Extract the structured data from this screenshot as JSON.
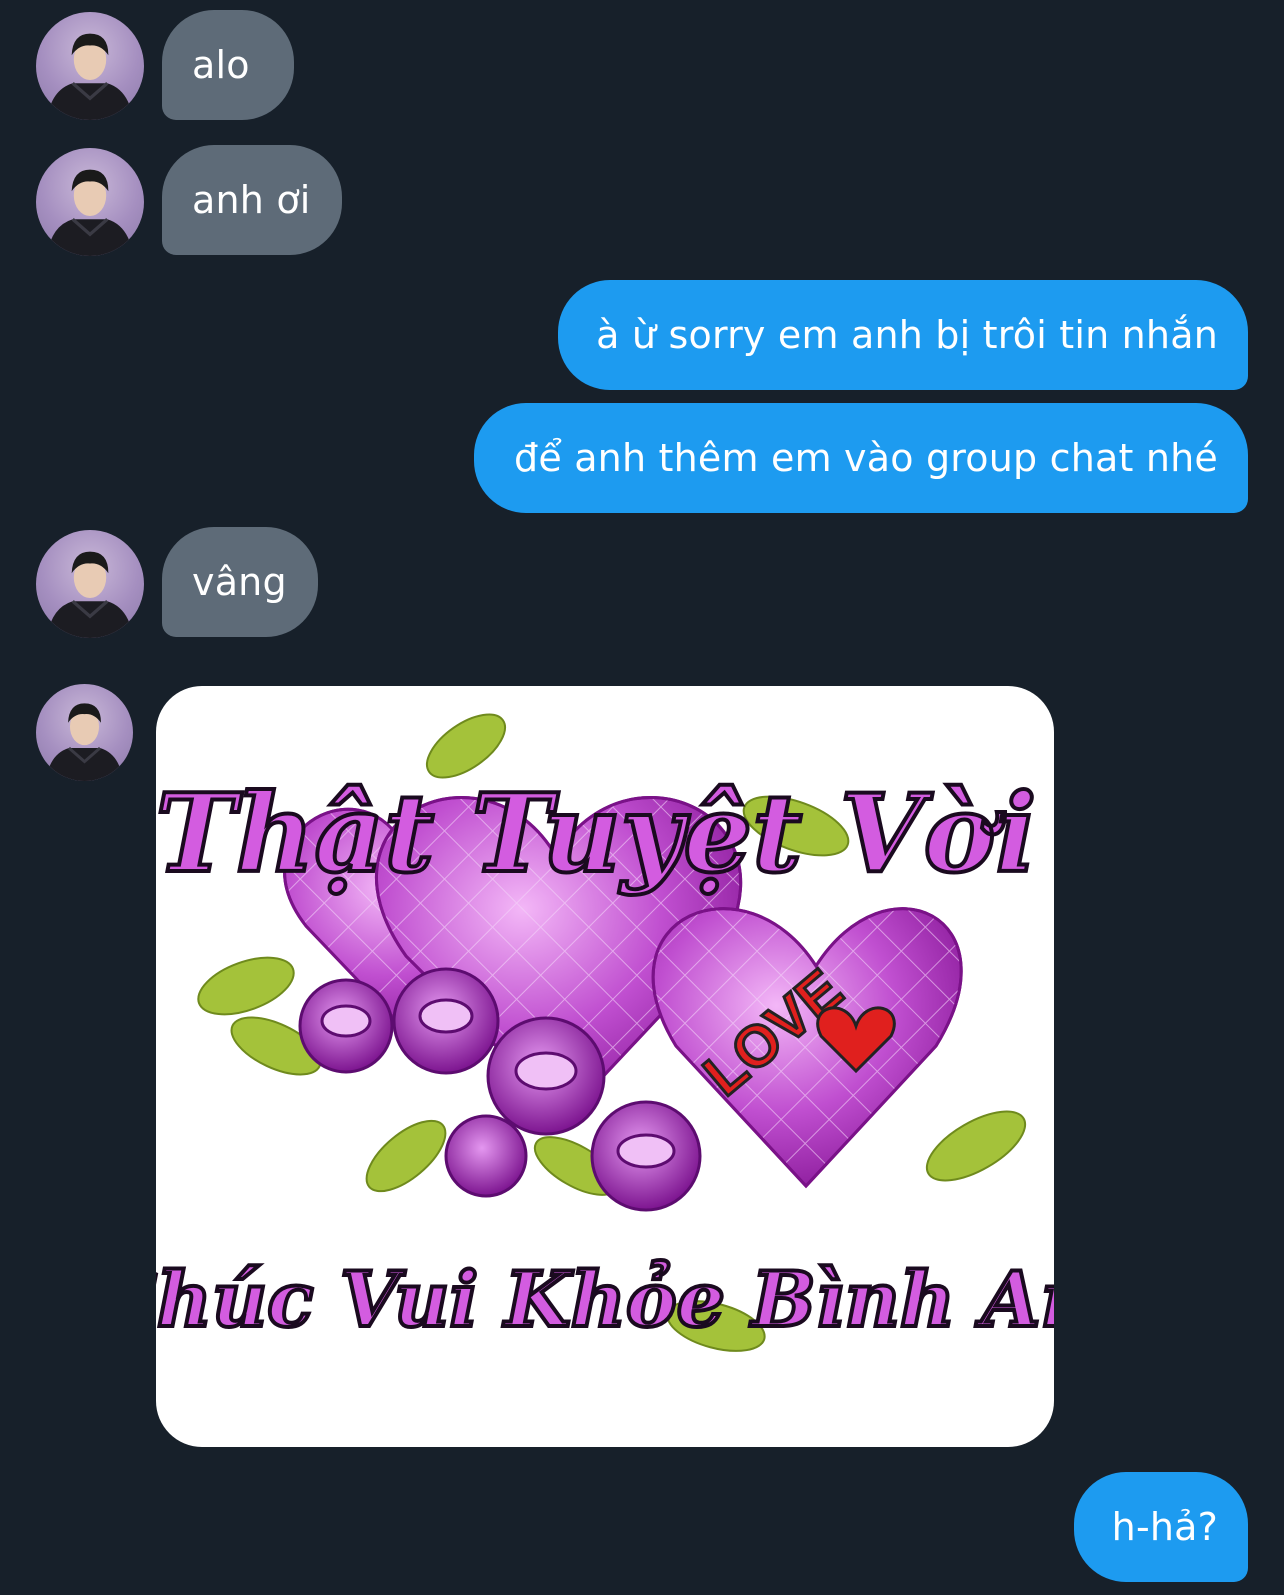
{
  "messages": [
    {
      "side": "in",
      "text": "alo"
    },
    {
      "side": "in",
      "text": "anh ơi"
    },
    {
      "side": "out",
      "text": "à ừ sorry em anh bị trôi tin nhắn"
    },
    {
      "side": "out",
      "text": "để anh thêm em vào group chat nhé"
    },
    {
      "side": "in",
      "text": "vâng"
    },
    {
      "side": "in",
      "type": "image",
      "image": {
        "title": "Thật Tuyệt Vời",
        "caption": "Chúc Vui Khỏe Bình An",
        "badge": "LOVE"
      }
    },
    {
      "side": "out",
      "text": "h-hả?"
    }
  ],
  "colors": {
    "background": "#17202a",
    "incoming_bubble": "#5e6b78",
    "outgoing_bubble": "#1d9bf0",
    "bubble_text": "#ffffff"
  },
  "icons": [
    "contact-avatar"
  ]
}
